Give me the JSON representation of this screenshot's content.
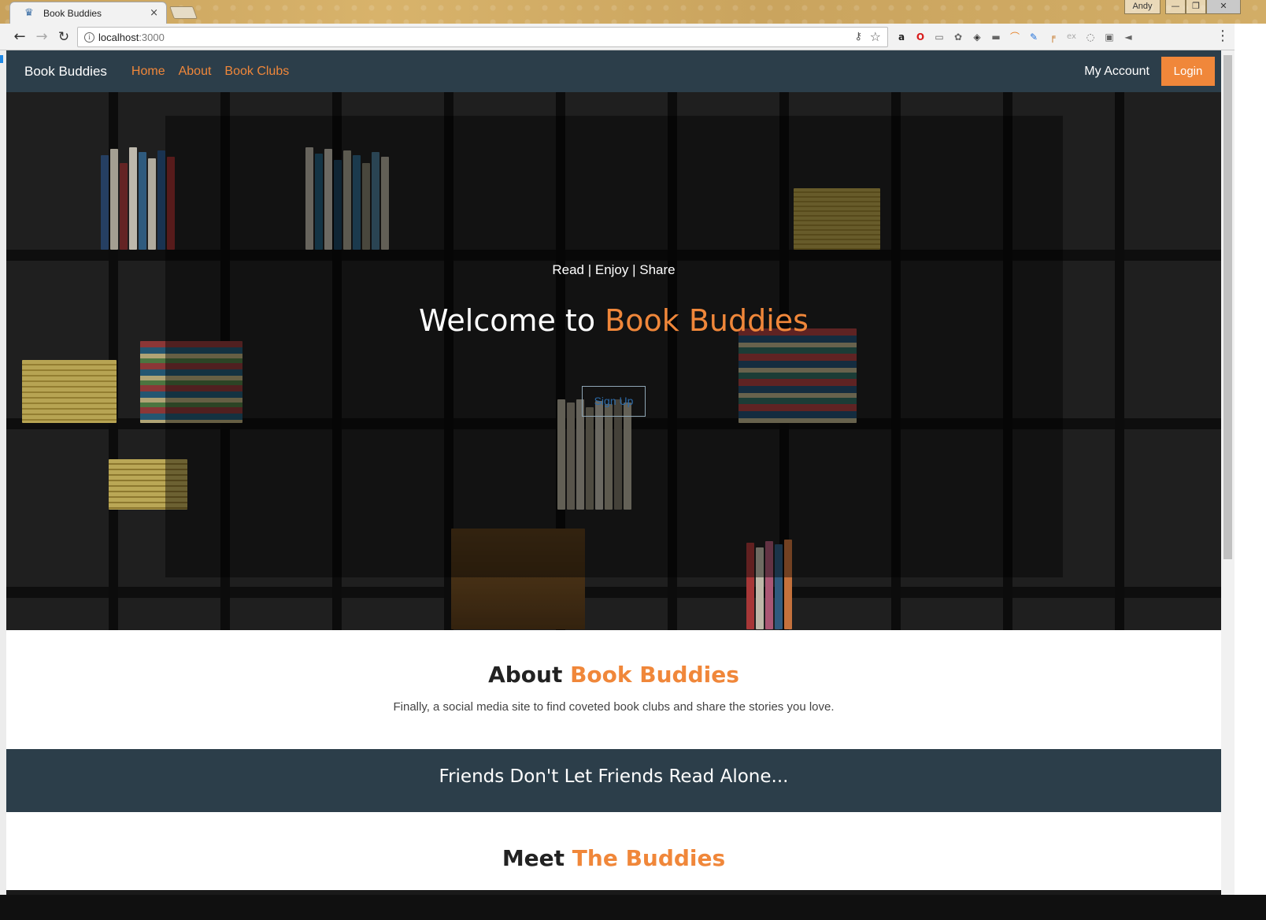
{
  "browser": {
    "tab_title": "Book Buddies",
    "tab_close": "×",
    "user_badge": "Andy",
    "window_buttons": [
      "—",
      "❐",
      "✕"
    ],
    "url_host": "localhost",
    "url_port": ":3000",
    "extensions": [
      "a",
      "O",
      "▭",
      "✿",
      "◈",
      "▬",
      "⌒",
      "✎",
      "╒",
      "ex",
      "◌",
      "▣",
      "◄"
    ]
  },
  "navbar": {
    "brand": "Book Buddies",
    "links": [
      "Home",
      "About",
      "Book Clubs"
    ],
    "account": "My Account",
    "login": "Login"
  },
  "hero": {
    "tagline": "Read | Enjoy | Share",
    "welcome_prefix": "Welcome to ",
    "welcome_accent": "Book Buddies",
    "signup": "Sign Up"
  },
  "about": {
    "title_prefix": "About ",
    "title_accent": "Book Buddies",
    "text": "Finally, a social media site to find coveted book clubs and share the stories you love."
  },
  "banner": {
    "text": "Friends Don't Let Friends Read Alone..."
  },
  "meet": {
    "title_prefix": "Meet ",
    "title_accent": "The Buddies"
  },
  "colors": {
    "accent": "#f0873a",
    "navbar_bg": "#2c3e4a"
  }
}
